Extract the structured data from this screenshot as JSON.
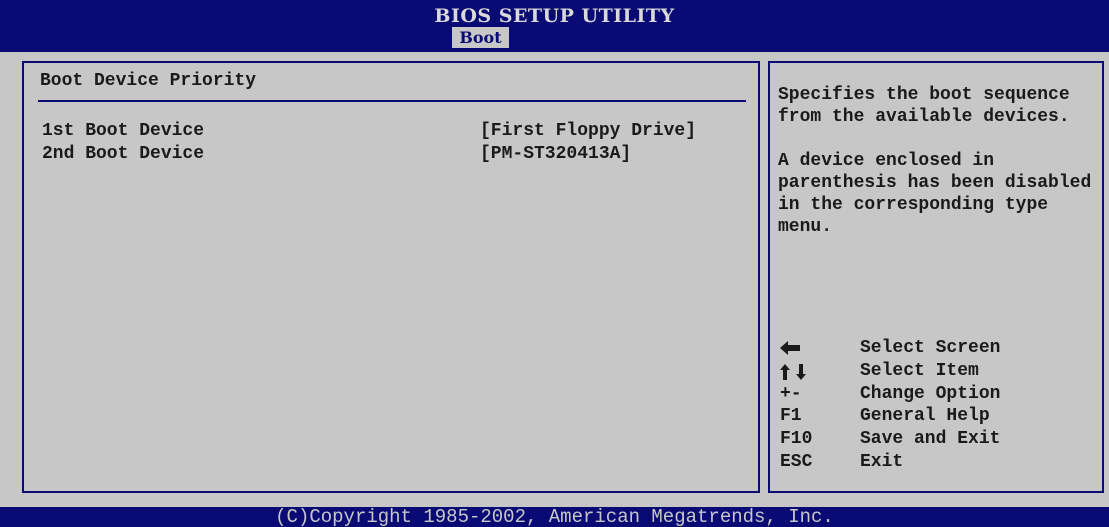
{
  "header": {
    "title": "BIOS SETUP UTILITY",
    "active_tab": "Boot"
  },
  "main": {
    "section_title": "Boot Device Priority",
    "items": [
      {
        "label": "1st Boot Device",
        "value": "[First Floppy Drive]"
      },
      {
        "label": "2nd Boot Device",
        "value": "[PM-ST320413A]"
      }
    ]
  },
  "help": {
    "paragraph1": "Specifies the boot sequence from the available devices.",
    "paragraph2": "A device enclosed in parenthesis has been disabled in the corresponding type menu."
  },
  "keys": [
    {
      "key_icon": "left-arrow-icon",
      "key": "",
      "description": "Select Screen"
    },
    {
      "key_icon": "up-down-arrows-icon",
      "key": "",
      "description": "Select Item"
    },
    {
      "key": "+-",
      "description": "Change Option"
    },
    {
      "key": "F1",
      "description": "General Help"
    },
    {
      "key": "F10",
      "description": "Save and Exit"
    },
    {
      "key": "ESC",
      "description": "Exit"
    }
  ],
  "footer": {
    "copyright": "(C)Copyright 1985-2002, American Megatrends, Inc."
  },
  "colors": {
    "background": "#0a0a74",
    "panel": "#c7c7c7",
    "text": "#1a1a1a"
  }
}
